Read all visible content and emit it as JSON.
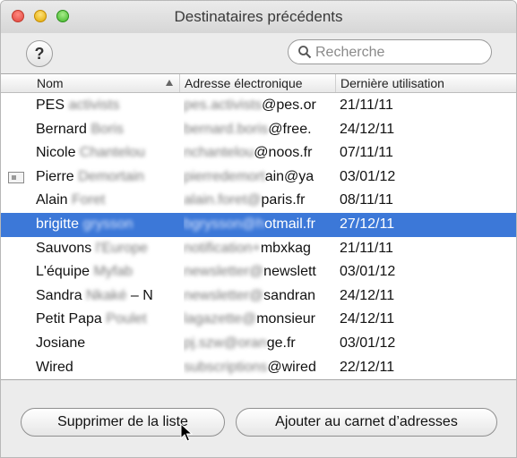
{
  "window": {
    "title": "Destinataires précédents"
  },
  "toolbar": {
    "help_label": "?",
    "search_placeholder": "Recherche",
    "search_value": ""
  },
  "table": {
    "headers": [
      "Nom",
      "Adresse électronique",
      "Dernière utilisation"
    ],
    "rows": [
      {
        "first": "PES",
        "last_blurred": "activists",
        "email_blurred": "pes.activists",
        "email_visible": "@pes.or",
        "date": "21/11/11",
        "icon": ""
      },
      {
        "first": "Bernard",
        "last_blurred": "Boris",
        "email_blurred": "bernard.boris",
        "email_visible": "@free.",
        "date": "24/12/11",
        "icon": ""
      },
      {
        "first": "Nicole",
        "last_blurred": "Chantelou",
        "email_blurred": "nchantelou",
        "email_visible": "@noos.fr",
        "date": "07/11/11",
        "icon": ""
      },
      {
        "first": "Pierre",
        "last_blurred": "Demortain",
        "email_blurred": "pierredemort",
        "email_visible": "ain@ya",
        "date": "03/01/12",
        "icon": "vcard-icon"
      },
      {
        "first": "Alain",
        "last_blurred": "Foret",
        "email_blurred": "alain.foret@",
        "email_visible": "paris.fr",
        "date": "08/11/11",
        "icon": ""
      },
      {
        "first": "brigitte",
        "last_blurred": "grysson",
        "email_blurred": "bgrysson@h",
        "email_visible": "otmail.fr",
        "date": "27/12/11",
        "icon": "",
        "selected": true
      },
      {
        "first": "Sauvons",
        "last_blurred": "l'Europe",
        "email_blurred": "notification+",
        "email_visible": "mbxkag",
        "date": "21/11/11",
        "icon": ""
      },
      {
        "first": "L'équipe",
        "last_blurred": "Myfab",
        "email_blurred": "newsletter@",
        "email_visible": "newslett",
        "date": "03/01/12",
        "icon": ""
      },
      {
        "first": "Sandra",
        "last_blurred": "Nkaké",
        "name_suffix": "– N",
        "email_blurred": "newsletter@",
        "email_visible": "sandran",
        "date": "24/12/11",
        "icon": ""
      },
      {
        "first": "Petit Papa",
        "last_blurred": "Poulet",
        "email_blurred": "lagazette@",
        "email_visible": "monsieur",
        "date": "24/12/11",
        "icon": ""
      },
      {
        "first": "Josiane",
        "last_blurred": "",
        "email_blurred": "pj.szw@oran",
        "email_visible": "ge.fr",
        "date": "03/01/12",
        "icon": ""
      },
      {
        "first": "Wired",
        "last_blurred": "",
        "email_blurred": "subscriptions",
        "email_visible": "@wired",
        "date": "22/12/11",
        "icon": ""
      }
    ]
  },
  "buttons": {
    "remove_label": "Supprimer de la liste",
    "add_label": "Ajouter au carnet d’adresses"
  },
  "colors": {
    "selection": "#3c78d8"
  }
}
